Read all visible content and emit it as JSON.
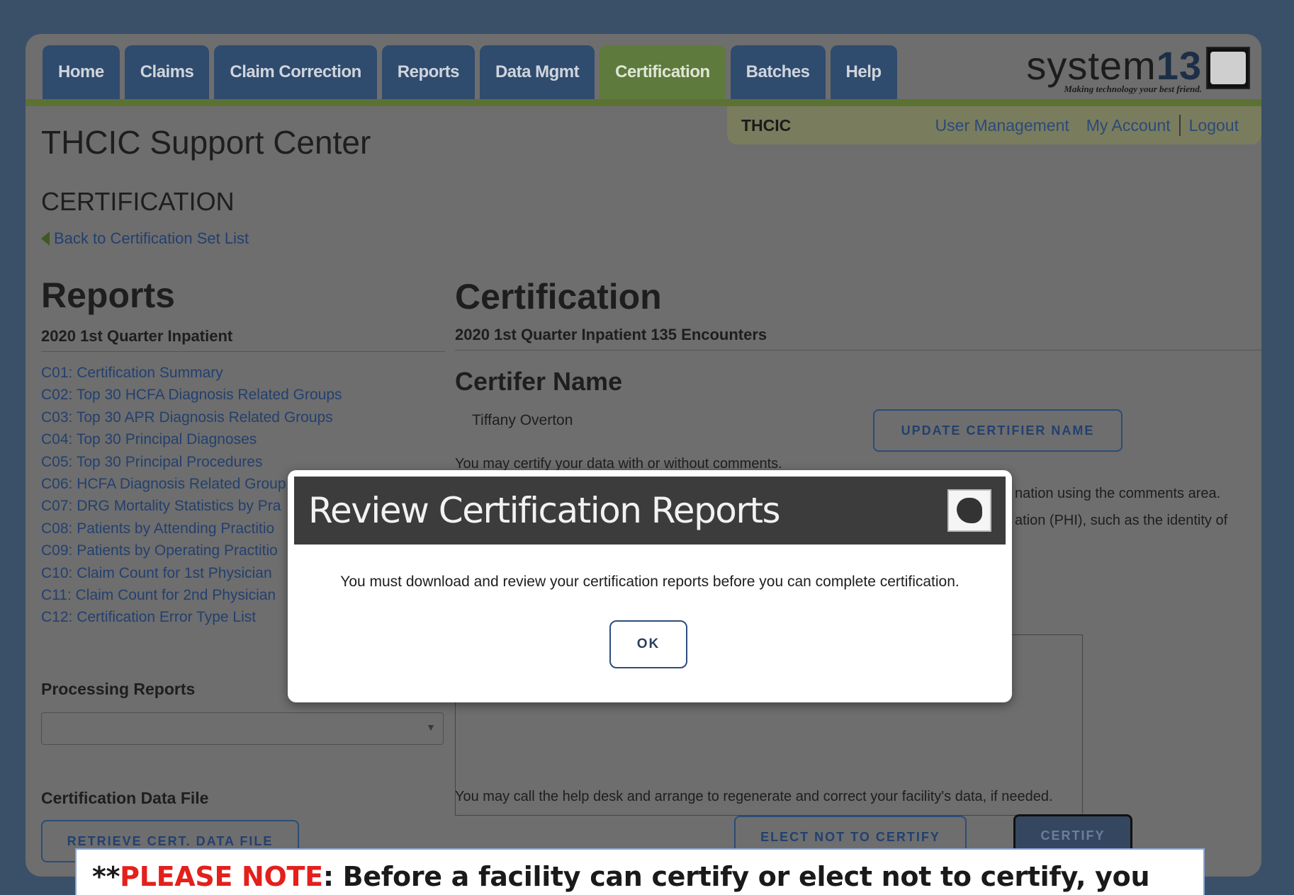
{
  "nav": {
    "tabs": [
      {
        "label": "Home",
        "active": false
      },
      {
        "label": "Claims",
        "active": false
      },
      {
        "label": "Claim Correction",
        "active": false
      },
      {
        "label": "Reports",
        "active": false
      },
      {
        "label": "Data Mgmt",
        "active": false
      },
      {
        "label": "Certification",
        "active": true
      },
      {
        "label": "Batches",
        "active": false
      },
      {
        "label": "Help",
        "active": false
      }
    ]
  },
  "logo": {
    "brand_prefix": "system",
    "brand_number": "13",
    "tagline": "Making technology your best friend."
  },
  "subnav": {
    "org": "THCIC",
    "links": [
      "User Management",
      "My Account",
      "Logout"
    ]
  },
  "site_title": "THCIC Support Center",
  "section_title": "CERTIFICATION",
  "back_link": "Back to Certification Set List",
  "reports": {
    "heading": "Reports",
    "subheading": "2020 1st Quarter Inpatient",
    "items": [
      "C01: Certification Summary",
      "C02: Top 30 HCFA Diagnosis Related Groups",
      "C03: Top 30 APR Diagnosis Related Groups",
      "C04: Top 30 Principal Diagnoses",
      "C05: Top 30 Principal Procedures",
      "C06: HCFA Diagnosis Related Group",
      "C07: DRG Mortality Statistics by Pra",
      "C08: Patients by Attending Practitio",
      "C09: Patients by Operating Practitio",
      "C10: Claim Count for 1st Physician",
      "C11: Claim Count for 2nd Physician",
      "C12: Certification Error Type List"
    ],
    "processing_heading": "Processing Reports",
    "cert_data_heading": "Certification Data File",
    "retrieve_button": "RETRIEVE CERT. DATA FILE"
  },
  "certification": {
    "heading": "Certification",
    "subheading": "2020 1st Quarter Inpatient 135 Encounters",
    "certifier_heading": "Certifer Name",
    "certifier_name": "Tiffany Overton",
    "update_button": "UPDATE CERTIFIER NAME",
    "line_certify": "You may certify your data with or without comments.",
    "line_comments": "nation using the comments area.",
    "line_phi": "ation (PHI), such as the identity of",
    "help_line": "You may call the help desk and arrange to regenerate and correct your facility's data, if needed.",
    "elect_button": "ELECT NOT TO CERTIFY",
    "certify_button": "CERTIFY"
  },
  "modal": {
    "title": "Review Certification Reports",
    "message": "You must download and review your certification reports before you can complete certification.",
    "ok_label": "OK"
  },
  "note": {
    "prefix": "**",
    "highlight": "PLEASE NOTE",
    "text": ":  Before a facility can certify or elect not to certify, you"
  },
  "colors": {
    "background": "#3a5068",
    "overlay_page": "#6e6e6e",
    "tab": "#2f4b6e",
    "tab_active": "#5e7a3c",
    "note_red": "#e3201b"
  }
}
